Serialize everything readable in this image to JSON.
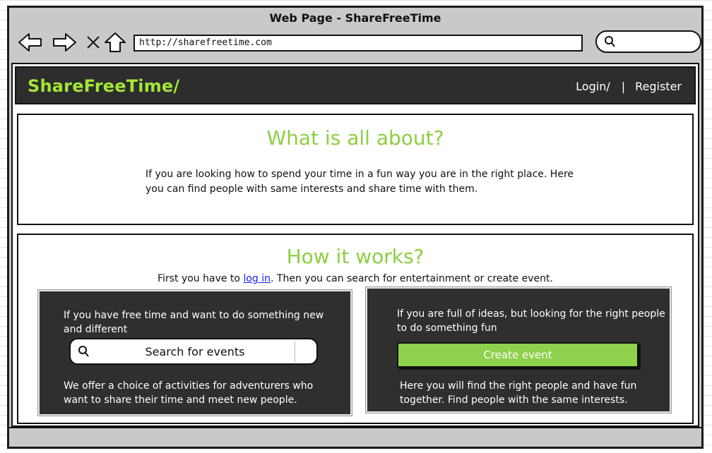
{
  "window": {
    "title": "Web Page - ShareFreeTime"
  },
  "browser": {
    "url": "http://sharefreetime.com",
    "search_value": ""
  },
  "site": {
    "logo": "ShareFreeTime/",
    "login": "Login/",
    "separator": "|",
    "register": "Register"
  },
  "about": {
    "title": "What is all about?",
    "text": "If you are looking how to spend your time in a fun way you are in the right place. Here you can find people with same interests and share time with them."
  },
  "how": {
    "title": "How it works?",
    "intro_before": "First you have to ",
    "intro_link": "log in",
    "intro_after": ". Then you can search for entertainment or create event.",
    "left_card": {
      "top_text": "If you have free time and want to do something new and different",
      "button": "Search for events",
      "bottom_text": "We offer a choice of activities for adventurers who want to share their time and meet new people."
    },
    "right_card": {
      "top_text": "If you are full of ideas, but looking for the right people to do something fun",
      "button": "Create event",
      "bottom_text": "Here you will find the right people and have fun together. Find people with the same interests."
    }
  },
  "colors": {
    "accent_green": "#8ccf3f",
    "logo_green": "#a3e635",
    "dark_panel": "#2f2f2f"
  }
}
